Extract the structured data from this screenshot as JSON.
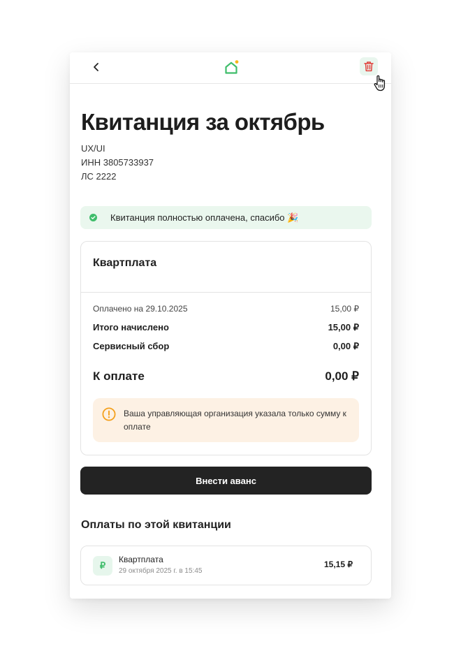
{
  "header": {
    "back_icon": "chevron-left-icon",
    "logo_icon": "home-icon",
    "delete_icon": "trash-icon"
  },
  "receipt": {
    "title": "Квитанция за октябрь",
    "company": "UX/UI",
    "inn": "ИНН 3805733937",
    "account": "ЛС 2222"
  },
  "status": {
    "text": "Квитанция полностью оплачена, спасибо 🎉",
    "icon": "check-circle-icon",
    "color": "#3fbd6b"
  },
  "summary": {
    "service_name": "Квартплата",
    "paid_label": "Оплачено на 29.10.2025",
    "paid_value": "15,00 ₽",
    "total_label": "Итого начислено",
    "total_value": "15,00 ₽",
    "fee_label": "Сервисный сбор",
    "fee_value": "0,00 ₽",
    "due_label": "К оплате",
    "due_value": "0,00 ₽",
    "notice": "Ваша управляющая организация указала только сумму к оплате",
    "notice_icon": "warning-icon",
    "notice_color": "#f4a01c"
  },
  "actions": {
    "advance_label": "Внести аванс"
  },
  "payments": {
    "title": "Оплаты по этой квитанции",
    "items": [
      {
        "icon": "₽",
        "name": "Квартплата",
        "date": "29 октября 2025 г. в 15:45",
        "amount": "15,15 ₽"
      }
    ]
  },
  "colors": {
    "accent_green": "#3fbd6b",
    "delete_red": "#e0423d",
    "button_dark": "#232323"
  }
}
